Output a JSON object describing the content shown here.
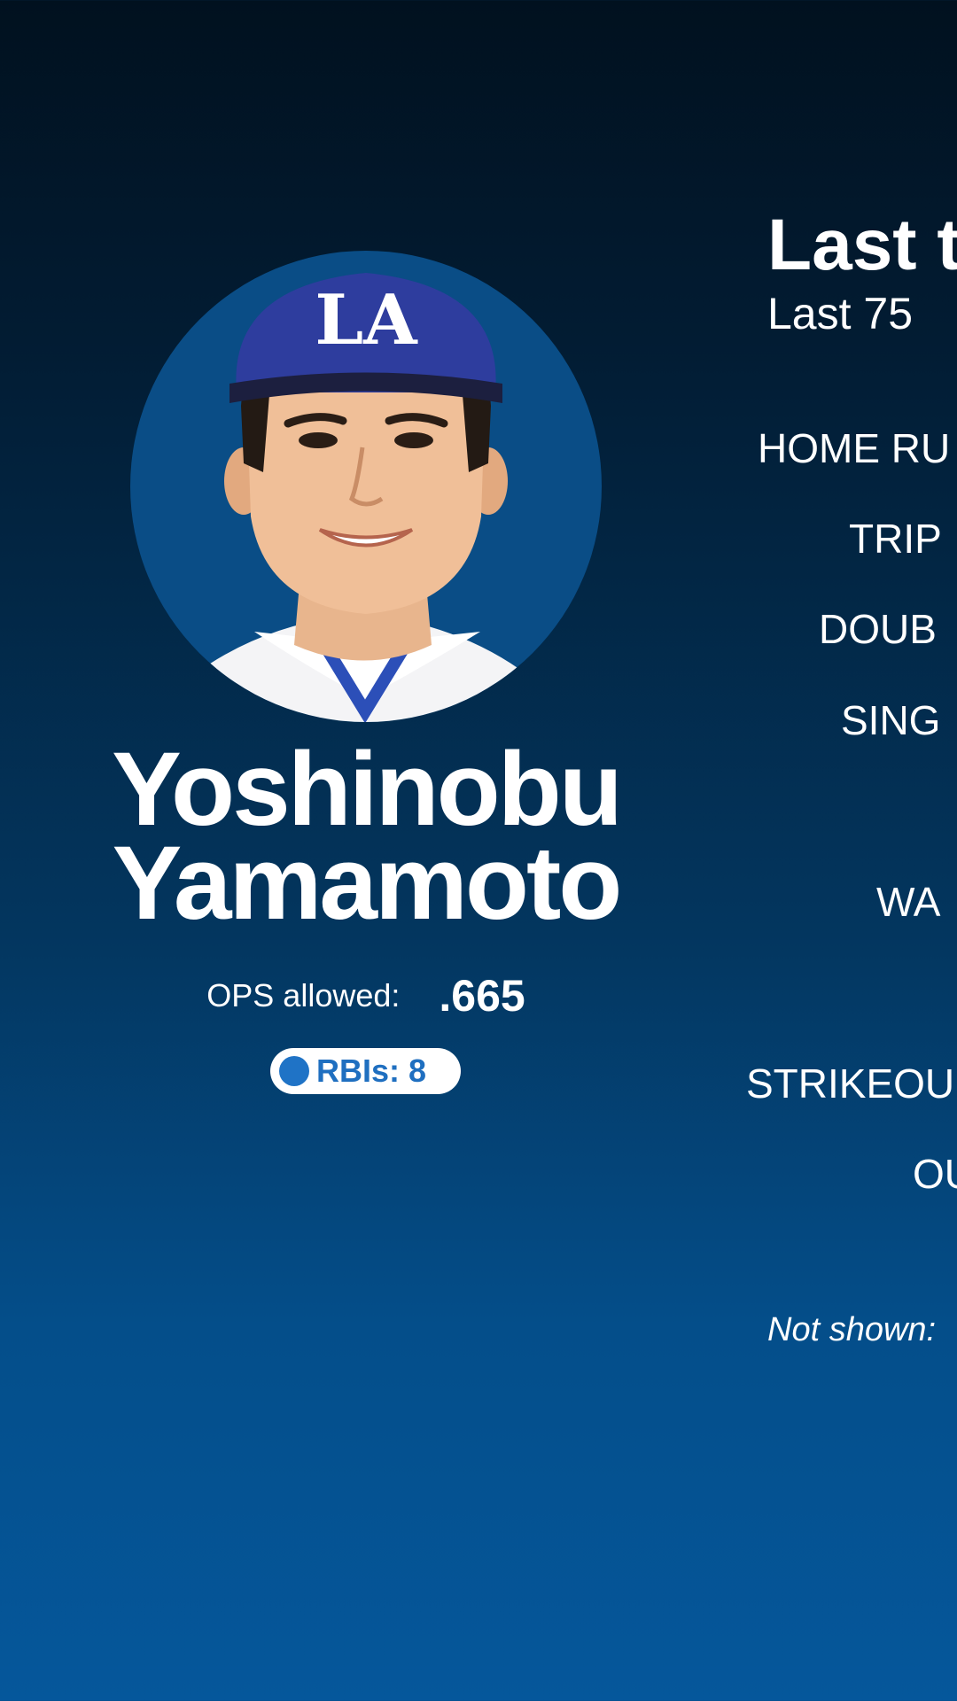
{
  "player": {
    "name_first": "Yoshinobu",
    "name_last": "Yamamoto",
    "ops_label": "OPS allowed:",
    "ops_value": ".665",
    "rbi_badge": "RBIs: 8",
    "cap_logo": "LA",
    "colors": {
      "avatar_bg": "#0a4d86",
      "cap": "#2e3d9e",
      "badge_dot": "#1f73c6"
    }
  },
  "panel": {
    "title": "Last t",
    "subtitle": "Last 75",
    "stats": [
      {
        "label": "HOME RU"
      },
      {
        "label": "TRIP"
      },
      {
        "label": "DOUB"
      },
      {
        "label": "SING"
      },
      {
        "label": "WA"
      },
      {
        "label": "STRIKEOU"
      },
      {
        "label": "OU"
      }
    ],
    "footnote": "Not shown:"
  }
}
